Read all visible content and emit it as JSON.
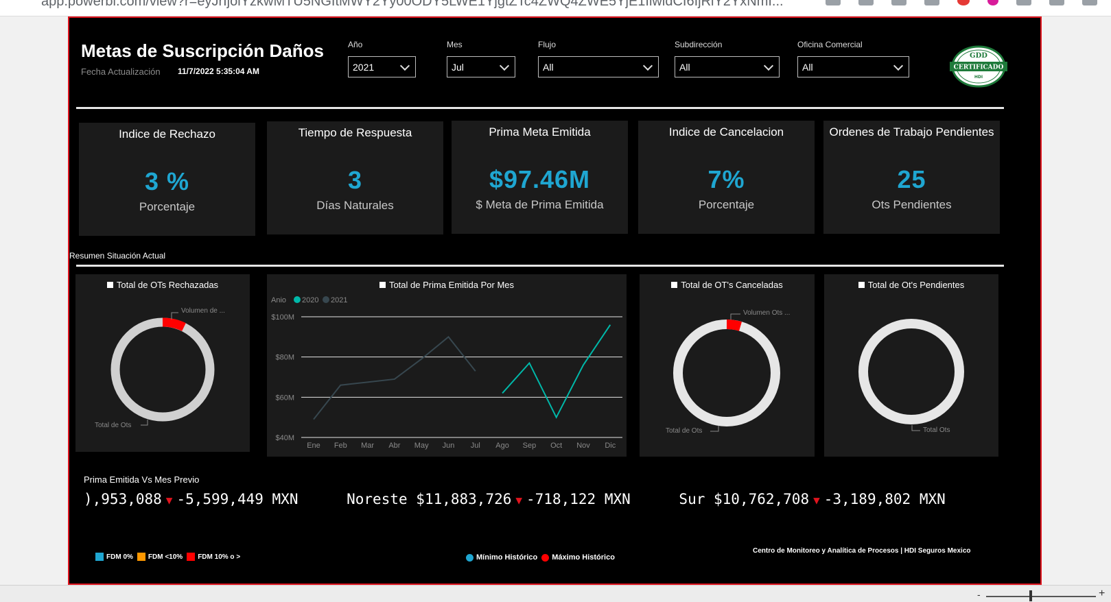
{
  "browser": {
    "url": "app.powerbi.com/view?r=eyJrIjoiYzkwMTU5NGItMWY2Yy00ODY5LWE1YjgtZTc4ZWQ4ZWE5YjE1IiwidCI6IjRiY2YxNmI..."
  },
  "header": {
    "title": "Metas de Suscripción Daños",
    "update_label": "Fecha Actualización",
    "update_value": "11/7/2022 5:35:04 AM"
  },
  "filters": [
    {
      "label": "Año",
      "value": "2021"
    },
    {
      "label": "Mes",
      "value": "Jul"
    },
    {
      "label": "Flujo",
      "value": "All"
    },
    {
      "label": "Subdirección",
      "value": "All"
    },
    {
      "label": "Oficina Comercial",
      "value": "All"
    }
  ],
  "logo": {
    "top": "GDD",
    "band": "CERTIFICADO",
    "bottom": "HDI"
  },
  "kpis": [
    {
      "title": "Indice de Rechazo",
      "value": "3 %",
      "subtitle": "Porcentaje"
    },
    {
      "title": "Tiempo de Respuesta",
      "value": "3",
      "subtitle": "Días Naturales"
    },
    {
      "title": "Prima Meta Emitida",
      "value": "$97.46M",
      "subtitle": "$ Meta de Prima Emitida"
    },
    {
      "title": "Indice de Cancelacion",
      "value": "7%",
      "subtitle": "Porcentaje"
    },
    {
      "title": "Ordenes de Trabajo Pendientes",
      "value": "25",
      "subtitle": "Ots Pendientes"
    }
  ],
  "section_label": "Resumen Situación Actual",
  "donuts": {
    "rechazadas": {
      "title": "Total de OTs Rechazadas",
      "label_volume": "Volumen de ...",
      "label_total": "Total de Ots"
    },
    "canceladas": {
      "title": "Total de OT's Canceladas",
      "label_volume": "Volumen Ots ...",
      "label_total": "Total de Ots"
    },
    "pendientes": {
      "title": "Total de Ot's Pendientes",
      "label_total": "Total Ots"
    }
  },
  "colors": {
    "kpi_value": "#1fa6d1",
    "series_2020": "#00b8a9",
    "series_2021": "#37474f",
    "donut_ring": "#e0e0e0",
    "donut_highlight": "#ff0000",
    "border": "#e0141e"
  },
  "chart_data": {
    "type": "line",
    "title": "Total de Prima Emitida Por Mes",
    "legend_title": "Anio",
    "legend_position": "top-left",
    "categories": [
      "Ene",
      "Feb",
      "Mar",
      "Abr",
      "May",
      "Jun",
      "Jul",
      "Ago",
      "Sep",
      "Oct",
      "Nov",
      "Dic"
    ],
    "series": [
      {
        "name": "2020",
        "values": [
          null,
          null,
          null,
          null,
          null,
          null,
          null,
          62,
          77,
          50,
          76,
          96
        ]
      },
      {
        "name": "2021",
        "values": [
          49,
          66,
          67.5,
          69,
          79,
          90,
          73,
          null,
          null,
          null,
          null,
          null
        ]
      }
    ],
    "ylim": [
      40,
      100
    ],
    "yticks": [
      40,
      60,
      80,
      100
    ],
    "ytick_labels": [
      "$40M",
      "$60M",
      "$80M",
      "$100M"
    ],
    "grid": true
  },
  "ticker": {
    "label": "Prima Emitida Vs Mes Previo",
    "items": [
      {
        "region": "",
        "value": "),953,088",
        "delta": "-5,599,449",
        "currency": "MXN"
      },
      {
        "region": "Noreste",
        "value": "$11,883,726",
        "delta": "-718,122",
        "currency": "MXN"
      },
      {
        "region": "Sur",
        "value": "$10,762,708",
        "delta": "-3,189,802",
        "currency": "MXN"
      }
    ]
  },
  "legend_fdm": [
    {
      "label": "FDM 0%",
      "color": "#1fa6d1"
    },
    {
      "label": "FDM <10%",
      "color": "#ff9800"
    },
    {
      "label": "FDM 10% o >",
      "color": "#ff0000"
    }
  ],
  "legend_historic": [
    {
      "label": "Mínimo Histórico",
      "color": "#1fa6d1"
    },
    {
      "label": "Máximo Histórico",
      "color": "#ff0000"
    }
  ],
  "footer": {
    "credit": "Centro de Monitoreo y Analítica de Procesos | HDI Seguros Mexico"
  },
  "zoom": {
    "minus": "-",
    "plus": "+"
  }
}
